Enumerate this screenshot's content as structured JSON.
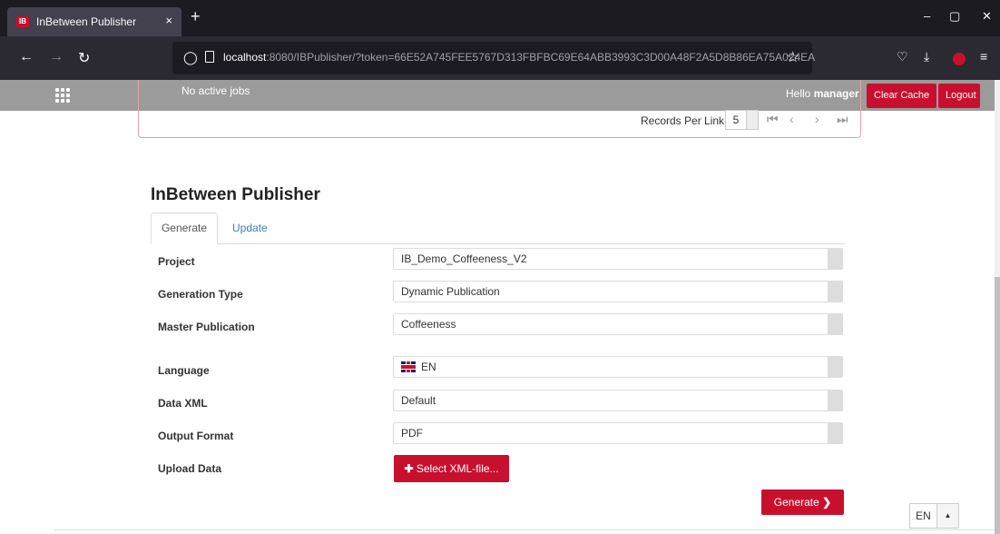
{
  "browser": {
    "tab_title": "InBetween Publisher",
    "tab_close": "×",
    "new_tab": "+",
    "url_host": "localhost",
    "url_rest": ":8080/IBPublisher/?token=66E52A745FEE5767D313FBFBC69E64ABB3993C3D00A48F2A5D8B86EA75A024EA",
    "win_min": "–",
    "win_restore": "▢",
    "win_close": "✕"
  },
  "header": {
    "jobs_status": "No active jobs",
    "greeting": "Hello",
    "username": "manager",
    "clear_cache": "Clear Cache",
    "logout": "Logout"
  },
  "jobs": {
    "records_per_link_label": "Records Per Link",
    "records_per_link_value": "5"
  },
  "main": {
    "title": "InBetween Publisher",
    "tabs": [
      {
        "label": "Generate"
      },
      {
        "label": "Update"
      }
    ],
    "fields": {
      "project": {
        "label": "Project",
        "value": "IB_Demo_Coffeeness_V2"
      },
      "generation_type": {
        "label": "Generation Type",
        "value": "Dynamic Publication"
      },
      "master_publication": {
        "label": "Master Publication",
        "value": "Coffeeness"
      },
      "language": {
        "label": "Language",
        "value": "EN"
      },
      "data_xml": {
        "label": "Data XML",
        "value": "Default"
      },
      "output_format": {
        "label": "Output Format",
        "value": "PDF"
      },
      "upload_data": {
        "label": "Upload Data"
      }
    },
    "select_xml_button": "Select XML-file...",
    "generate_button": "Generate"
  },
  "footer": {
    "language": "EN"
  },
  "colors": {
    "accent": "#c8102e",
    "header_gray": "#9b9b9b",
    "link_blue": "#3b7dbd"
  }
}
